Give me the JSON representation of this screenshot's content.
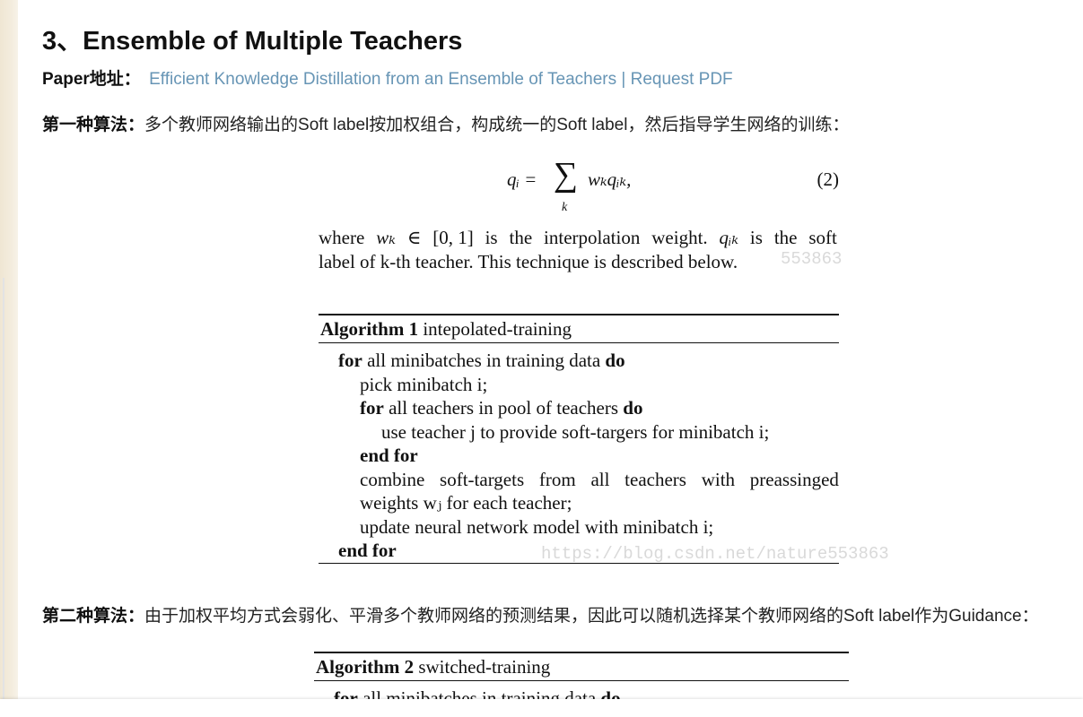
{
  "heading": "3、Ensemble of Multiple Teachers",
  "paper": {
    "label": "Paper地址：",
    "link_text": "Efficient Knowledge Distillation from an Ensemble of Teachers | Request PDF"
  },
  "para1": {
    "label": "第一种算法：",
    "text": "多个教师网络输出的Soft label按加权组合，构成统一的Soft label，然后指导学生网络的训练："
  },
  "equation": {
    "lhs": "qᵢ =",
    "sum_index": "k",
    "rhs": "wₖqᵢₖ,",
    "number": "(2)"
  },
  "where_text": {
    "line1_parts": [
      "where",
      "wₖ",
      "∈",
      "[0, 1]",
      "is",
      "the",
      "interpolation",
      "weight.",
      "qᵢₖ",
      "is",
      "the",
      "soft"
    ],
    "line2": "label of k-th teacher. This technique is described below."
  },
  "watermarks": {
    "wm1": "553863",
    "wm2": "https://blog.csdn.net/nature553863"
  },
  "algorithm1": {
    "title_bold": "Algorithm 1",
    "title_rest": " intepolated-training",
    "lines": [
      {
        "kw1": "for",
        "text": " all minibatches in training data ",
        "kw2": "do"
      },
      {
        "text": "pick minibatch i;"
      },
      {
        "kw1": "for",
        "text": " all teachers in pool of teachers ",
        "kw2": "do"
      },
      {
        "text": "use teacher j to provide soft-targers for minibatch i;"
      },
      {
        "kw1": "end for"
      },
      {
        "parts": [
          "combine",
          "soft-targets",
          "from",
          "all",
          "teachers",
          "with",
          "preassinged"
        ]
      },
      {
        "text": "weights wⱼ for each teacher;"
      },
      {
        "text": "update neural network model with minibatch i;"
      },
      {
        "kw1": "end for"
      }
    ]
  },
  "para2": {
    "label": "第二种算法：",
    "text": "由于加权平均方式会弱化、平滑多个教师网络的预测结果，因此可以随机选择某个教师网络的Soft label作为Guidance："
  },
  "algorithm2": {
    "title_bold": "Algorithm 2",
    "title_rest": " switched-training",
    "first_line_kw1": "for",
    "first_line_text": " all minibatches in training data ",
    "first_line_kw2": "do"
  }
}
